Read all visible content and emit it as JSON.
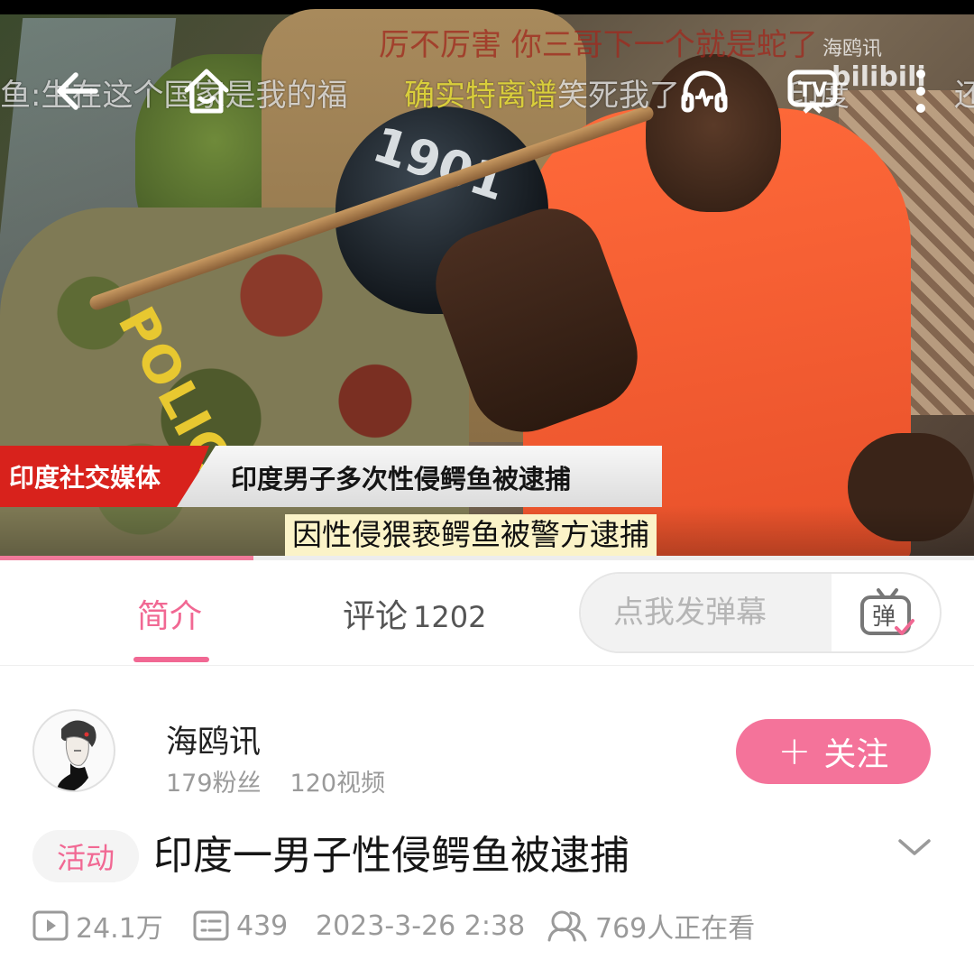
{
  "video": {
    "danmaku": [
      "厉不厉害  你三哥下一个就是蛇了",
      "鱼:生在这个国家是我的福",
      "确实特离谱",
      "笑死我了",
      "印度",
      "还是对鳄鱼"
    ],
    "watermark_author": "海鸥讯",
    "watermark_brand": "bilibili",
    "news_source_tag": "印度社交媒体",
    "news_headline": "印度男子多次性侵鳄鱼被逮捕",
    "news_caption": "因性侵猥亵鳄鱼被警方逮捕",
    "police_text": "POLICE",
    "helmet_text": "1901",
    "tv_label": "TV",
    "controls": [
      "back-arrow-icon",
      "home-icon",
      "headphones-icon",
      "tv-cast-icon",
      "more-vertical-icon"
    ],
    "progress_fraction": 0.26
  },
  "tabs": {
    "intro": "简介",
    "comments": "评论",
    "comments_count": "1202",
    "danmaku_placeholder": "点我发弹幕",
    "danmaku_button": "弹"
  },
  "uploader": {
    "name": "海鸥讯",
    "fans": "179粉丝",
    "videos": "120视频",
    "follow_label": "关注",
    "follow_icon": "+"
  },
  "title": {
    "badge": "活动",
    "text": "印度一男子性侵鳄鱼被逮捕"
  },
  "meta": {
    "views": "24.1万",
    "danmaku_count": "439",
    "date": "2023-3-26 2:38",
    "watching": "769人正在看"
  },
  "colors": {
    "accent_pink": "#f16893",
    "follow_bg": "#f4739a",
    "news_red": "#d8221c"
  }
}
